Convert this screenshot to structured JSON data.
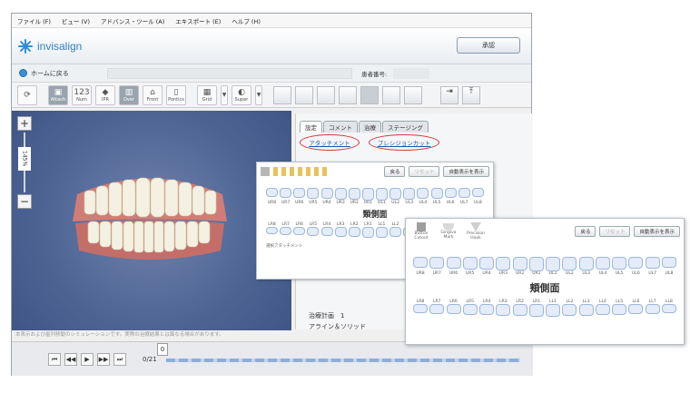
{
  "menu": [
    "ファイル (F)",
    "ビュー (V)",
    "アドバンス・ツール (A)",
    "エキスポート (E)",
    "ヘルプ (H)"
  ],
  "brand": {
    "name": "invisalign",
    "approve_label": "承認"
  },
  "nav": {
    "home_label": "ホームに戻る",
    "patient_no_label": "患者番号:"
  },
  "toolbar": [
    {
      "icon": "attach-icon",
      "label": "Attach",
      "active": true
    },
    {
      "icon": "num-icon",
      "label": "Num",
      "glyph": "123"
    },
    {
      "icon": "ipr-icon",
      "label": "IPR"
    },
    {
      "icon": "over-icon",
      "label": "Over",
      "active": true
    },
    {
      "icon": "front-icon",
      "label": "Front"
    },
    {
      "icon": "pontics-icon",
      "label": "Pontics"
    },
    {
      "icon": "grid-icon",
      "label": "Grid"
    },
    {
      "icon": "super-icon",
      "label": "Super"
    }
  ],
  "zoom": {
    "plus": "+",
    "minus": "−",
    "level": "145%"
  },
  "viewer_caption": "本表示および歯列移動のシミュレーションです。実際の治療結果とは異なる場合があります。",
  "timeline": {
    "stage_text": "0/21",
    "current": "0"
  },
  "panel": {
    "tabs": [
      "設定",
      "コメント",
      "治療",
      "ステージング"
    ],
    "link_attachment": "アタッチメント",
    "link_precision": "プレシジョンカット",
    "plan_label": "治療計画",
    "plan_number": "1",
    "plan_sub": "アライン＆ソリッド"
  },
  "popup1": {
    "buttons": [
      "戻る",
      "リセット",
      "自動表示を表示"
    ],
    "heading": "類側面",
    "upper_labels": [
      "UR8",
      "UR7",
      "UR6",
      "UR5",
      "UR4",
      "UR3",
      "UR2",
      "UR1",
      "UL1",
      "UL2",
      "UL3",
      "UL4",
      "UL5",
      "UL6",
      "UL7",
      "UL8"
    ],
    "lower_labels": [
      "LR8",
      "LR7",
      "LR6",
      "LR5",
      "LR4",
      "LR3",
      "LR2",
      "LR1",
      "LL1",
      "LL2",
      "LL3",
      "LL4",
      "LL5",
      "LL6",
      "LL7",
      "LL8"
    ],
    "note": "選択アタッチメント"
  },
  "popup2": {
    "tools": [
      "Button Cutout",
      "Gingiva Mark",
      "Precision Hook"
    ],
    "buttons": [
      "戻る",
      "リセット",
      "自動表示を表示"
    ],
    "heading": "頬側面",
    "upper_labels": [
      "UR8",
      "UR7",
      "UR6",
      "UR5",
      "UR4",
      "UR3",
      "UR2",
      "UR1",
      "UL1",
      "UL2",
      "UL3",
      "UL4",
      "UL5",
      "UL6",
      "UL7",
      "UL8"
    ],
    "lower_labels": [
      "LR8",
      "LR7",
      "LR6",
      "LR5",
      "LR4",
      "LR3",
      "LR2",
      "LR1",
      "LL1",
      "LL2",
      "LL3",
      "LL4",
      "LL5",
      "LL6",
      "LL7",
      "LL8"
    ]
  },
  "colors": {
    "accent": "#2f7fc0",
    "highlight": "#d43c3c",
    "viewer_bg": "#4e6594"
  }
}
